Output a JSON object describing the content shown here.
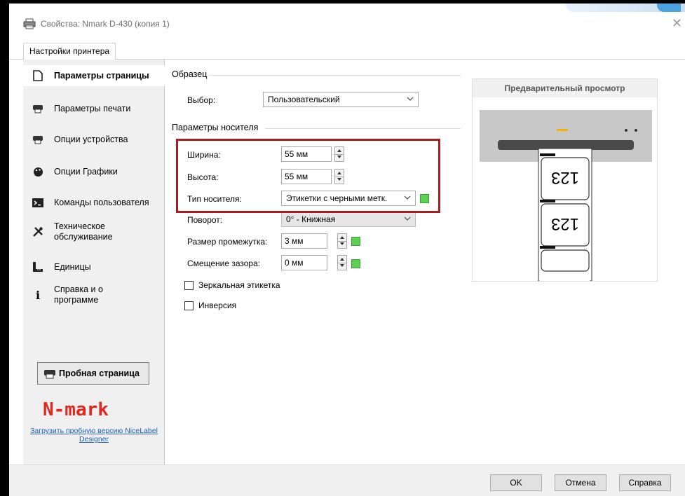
{
  "window": {
    "title": "Свойства: Nmark D-430 (копия 1)"
  },
  "tabs": [
    {
      "label": "Настройки принтера"
    }
  ],
  "sidebar": {
    "items": [
      {
        "label": "Параметры страницы",
        "icon": "page-icon"
      },
      {
        "label": "Параметры печати",
        "icon": "printer-icon"
      },
      {
        "label": "Опции устройства",
        "icon": "printer-icon"
      },
      {
        "label": "Опции Графики",
        "icon": "palette-icon"
      },
      {
        "label": "Команды пользователя",
        "icon": "terminal-icon"
      },
      {
        "label": "Техническое обслуживание",
        "icon": "tools-icon"
      },
      {
        "label": "Единицы",
        "icon": "ruler-icon"
      },
      {
        "label": "Справка и о программе",
        "icon": "info-icon"
      }
    ],
    "test_page_label": "Пробная страница",
    "brand_logo": "N-mark",
    "download_link": "Загрузить пробную версию NiceLabel Designer"
  },
  "sample": {
    "group_label": "Образец",
    "selection_label": "Выбор:",
    "selection_value": "Пользовательский"
  },
  "media": {
    "group_label": "Параметры носителя",
    "width_label": "Ширина:",
    "width_value": "55 мм",
    "height_label": "Высота:",
    "height_value": "55 мм",
    "type_label": "Тип носителя:",
    "type_value": "Этикетки с черными метк.",
    "rotation_label": "Поворот:",
    "rotation_value": "0° - Книжная",
    "gap_label": "Размер промежутка:",
    "gap_value": "3 мм",
    "offset_label": "Смещение зазора:",
    "offset_value": "0 мм",
    "mirror_label": "Зеркальная этикетка",
    "invert_label": "Инверсия"
  },
  "preview": {
    "header": "Предварительный просмотр",
    "label_text": "123"
  },
  "buttons": {
    "ok": "OK",
    "cancel": "Отмена",
    "help": "Справка"
  },
  "colors": {
    "highlight": "#a51e22",
    "brand_red": "#e0281e",
    "green_indicator": "#5fcf54",
    "link": "#1f5fbf"
  }
}
